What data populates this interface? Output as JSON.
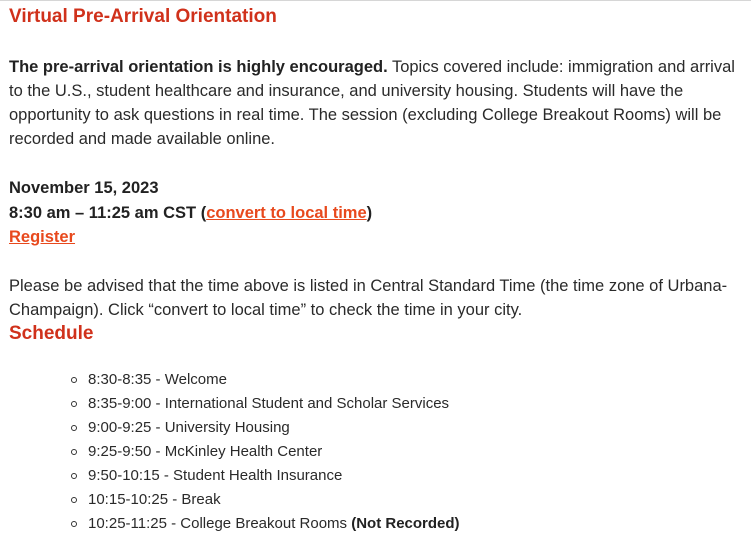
{
  "title": "Virtual Pre-Arrival Orientation",
  "intro": {
    "lead": "The pre-arrival orientation is highly encouraged.",
    "body": " Topics covered include: immigration and arrival to the U.S., student healthcare and insurance, and university housing. Students will have the opportunity to ask questions in real time. The session (excluding College Breakout Rooms) will be recorded and made available online."
  },
  "event": {
    "date": "November 15, 2023",
    "time_prefix": "8:30 am – 11:25 am CST (",
    "convert_link": "convert to local time",
    "time_suffix": ")",
    "register_link": "Register"
  },
  "notice": "Please be advised that the time above is listed in Central Standard Time (the time zone of Urbana-Champaign). Click “convert to local time” to check the time in your city.",
  "schedule": {
    "heading": "Schedule",
    "items": [
      {
        "text": "8:30-8:35 - Welcome",
        "note": ""
      },
      {
        "text": "8:35-9:00 - International Student and Scholar Services",
        "note": ""
      },
      {
        "text": "9:00-9:25 - University Housing",
        "note": ""
      },
      {
        "text": "9:25-9:50 - McKinley Health Center",
        "note": ""
      },
      {
        "text": "9:50-10:15 - Student Health Insurance",
        "note": ""
      },
      {
        "text": "10:15-10:25 - Break",
        "note": ""
      },
      {
        "text": "10:25-11:25 - College Breakout Rooms ",
        "note": "(Not Recorded)"
      }
    ]
  },
  "colors": {
    "heading": "#d0311b",
    "link": "#e8491d",
    "text": "#2a2a2a"
  }
}
